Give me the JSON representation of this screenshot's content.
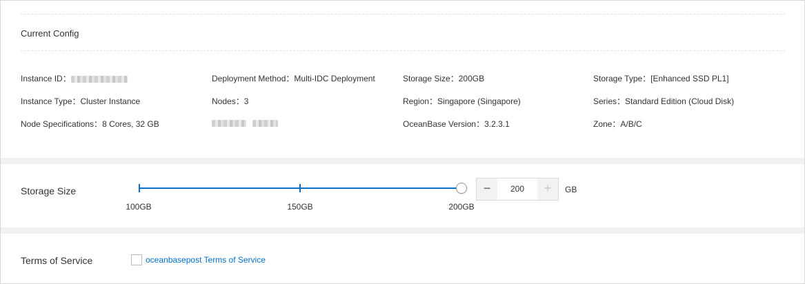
{
  "current_config": {
    "title": "Current Config",
    "rows": [
      [
        {
          "key": "Instance ID：",
          "value": ""
        },
        {
          "key": "Deployment Method：",
          "value": "Multi-IDC Deployment"
        },
        {
          "key": "Storage Size：",
          "value": "200GB"
        },
        {
          "key": "Storage Type：",
          "value": "[Enhanced SSD PL1]"
        }
      ],
      [
        {
          "key": "Instance Type：",
          "value": "Cluster Instance"
        },
        {
          "key": "Nodes：",
          "value": "3"
        },
        {
          "key": "Region：",
          "value": "Singapore (Singapore)"
        },
        {
          "key": "Series：",
          "value": "Standard Edition (Cloud Disk)"
        }
      ],
      [
        {
          "key": "Node Specifications：",
          "value": "8 Cores, 32 GB"
        },
        {
          "key": "",
          "value": ""
        },
        {
          "key": "OceanBase Version：",
          "value": "3.2.3.1"
        },
        {
          "key": "Zone：",
          "value": "A/B/C"
        }
      ]
    ]
  },
  "storage": {
    "label": "Storage Size",
    "marks": [
      "100GB",
      "150GB",
      "200GB"
    ],
    "min": 100,
    "max": 200,
    "selected": 200,
    "value": "200",
    "unit": "GB",
    "minus": "−",
    "plus": "+"
  },
  "terms": {
    "label": "Terms of Service",
    "link_text": "oceanbasepost Terms of Service"
  }
}
